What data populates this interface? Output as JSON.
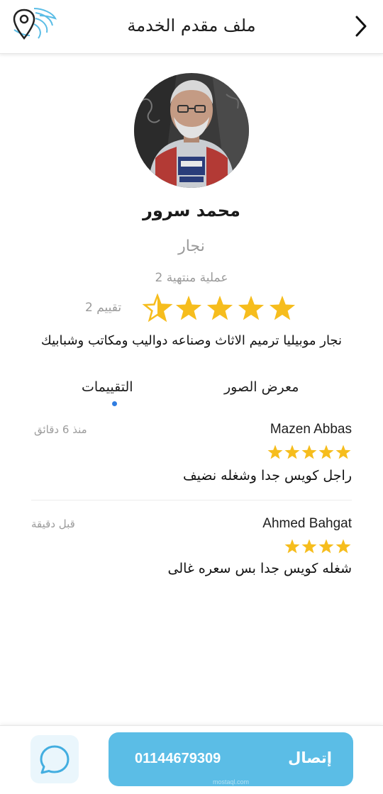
{
  "header": {
    "title": "ملف مقدم الخدمة",
    "logo_icon": "location-pin-logo-icon",
    "back_icon": "chevron-right-icon"
  },
  "profile": {
    "name": "محمد سرور",
    "profession": "نجار",
    "completed_jobs": "2 عملية منتهية",
    "rating_value": 4.5,
    "rating_max": 5,
    "rating_count": "2 تقييم",
    "bio": "نجار موبيليا ترميم الاثاث وصناعه دواليب ومكاتب وشبابيك"
  },
  "tabs": [
    {
      "label": "معرض الصور",
      "active": false
    },
    {
      "label": "التقييمات",
      "active": true
    }
  ],
  "reviews": [
    {
      "name": "Mazen Abbas",
      "time": "منذ 6 دقائق",
      "stars": 5,
      "text": "راجل كويس جدا وشغله نضيف"
    },
    {
      "name": "Ahmed Bahgat",
      "time": "قبل دقيقة",
      "stars": 4,
      "text": "شغله كويس جدا بس سعره غالى"
    }
  ],
  "actions": {
    "call_label": "إتصال",
    "phone": "01144679309",
    "chat_icon": "chat-bubble-icon",
    "watermark": "mostaql.com"
  },
  "colors": {
    "accent": "#5bbde6",
    "star": "#f6bd1d",
    "tab_indicator": "#2f7de1",
    "muted_text": "#9a9a9a"
  }
}
